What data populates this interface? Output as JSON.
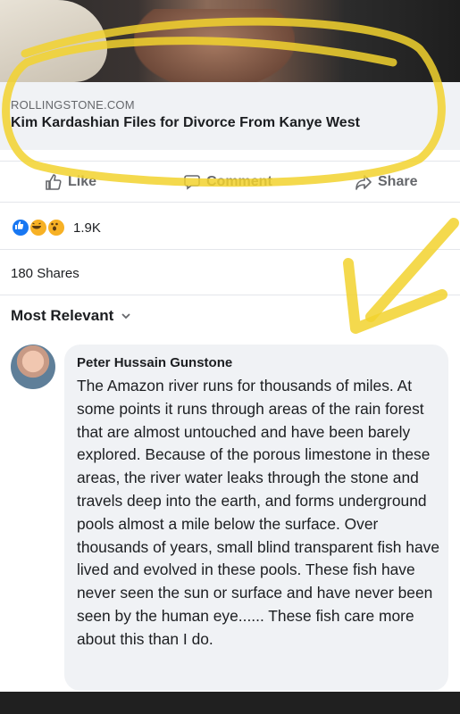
{
  "link_preview": {
    "domain": "ROLLINGSTONE.COM",
    "headline": "Kim Kardashian Files for Divorce From Kanye West"
  },
  "actions": {
    "like": "Like",
    "comment": "Comment",
    "share": "Share"
  },
  "reactions": {
    "count": "1.9K",
    "types": [
      "like-icon",
      "haha-icon",
      "wow-icon"
    ]
  },
  "shares": "180 Shares",
  "comments_sort": "Most Relevant",
  "comment": {
    "author": "Peter Hussain Gunstone",
    "text": "The Amazon river runs for thousands of miles.  At some points it runs through areas of the rain forest that are almost untouched and have been barely explored.  Because of the porous limestone in these areas, the river water leaks through the stone and travels deep into the earth, and forms underground pools almost a mile below the surface.  Over thousands of years, small blind transparent fish have lived and evolved in these pools.  These fish have never seen the sun or surface and have never been seen by the human eye......  These fish care more about this than I do."
  },
  "colors": {
    "annotation": "#f2d22e",
    "link_card_bg": "#f0f2f5",
    "muted_text": "#65676b"
  }
}
